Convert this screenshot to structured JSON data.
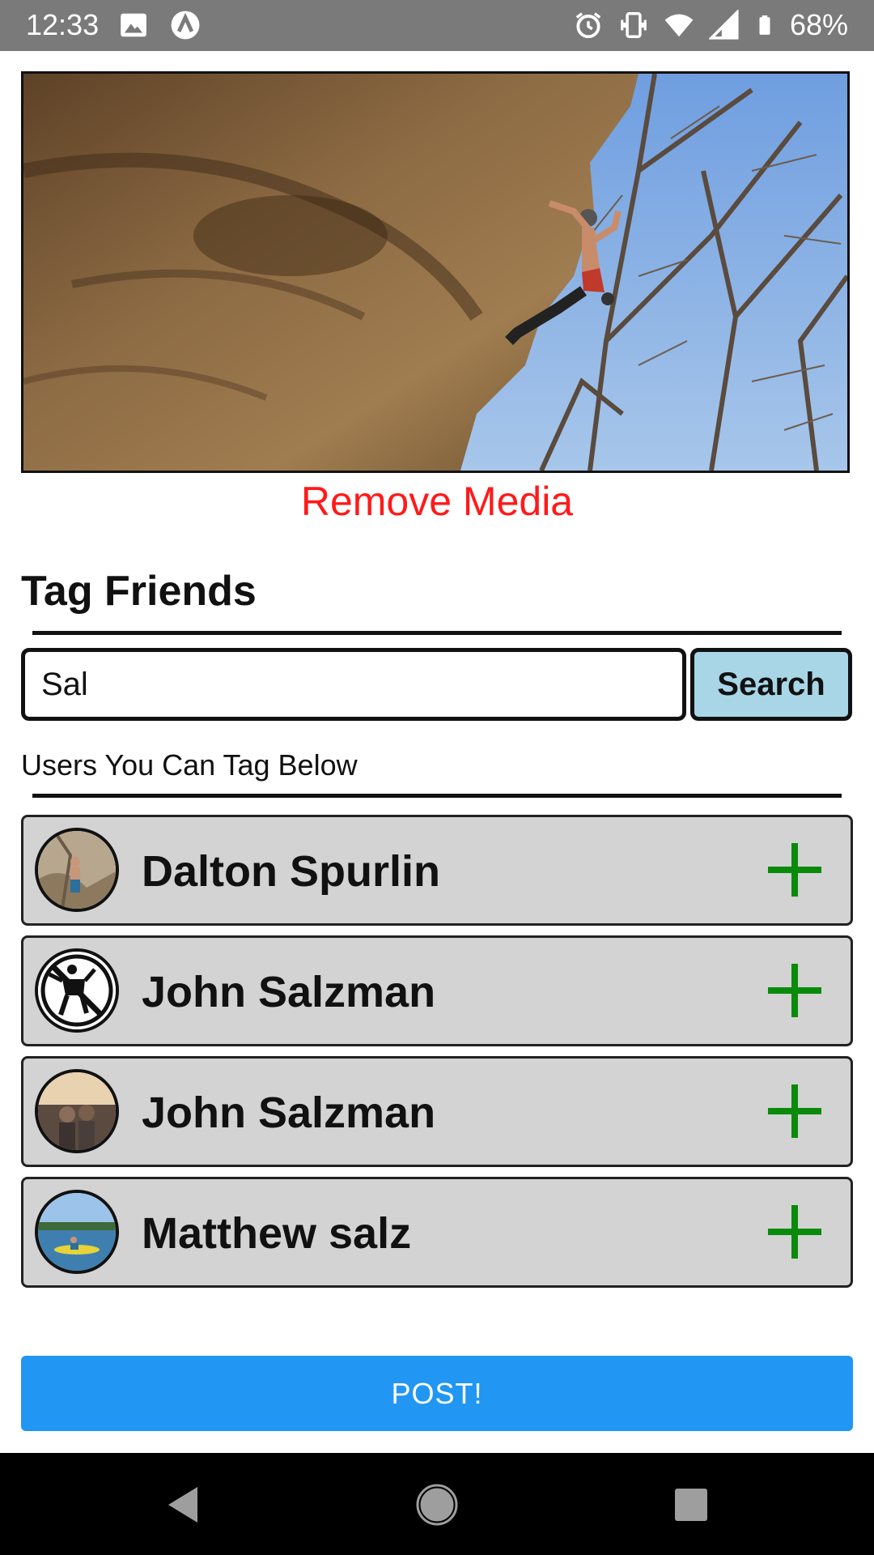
{
  "status_bar": {
    "time": "12:33",
    "battery": "68%",
    "icons": [
      "image-icon",
      "app-icon",
      "alarm-icon",
      "vibrate-icon",
      "wifi-icon",
      "signal-icon",
      "battery-icon"
    ]
  },
  "media": {
    "remove_label": "Remove Media"
  },
  "tag_section": {
    "title": "Tag Friends",
    "search_value": "Sal",
    "search_button": "Search",
    "users_label": "Users You Can Tag Below"
  },
  "users": [
    {
      "name": "Dalton Spurlin"
    },
    {
      "name": "John Salzman"
    },
    {
      "name": "John Salzman"
    },
    {
      "name": "Matthew salz"
    }
  ],
  "post_button": "POST!",
  "colors": {
    "remove": "#ff1a1a",
    "add": "#0a8a0a",
    "search_button_bg": "#a8d6e6",
    "post_bg": "#2196f3",
    "row_bg": "#d3d3d3"
  }
}
